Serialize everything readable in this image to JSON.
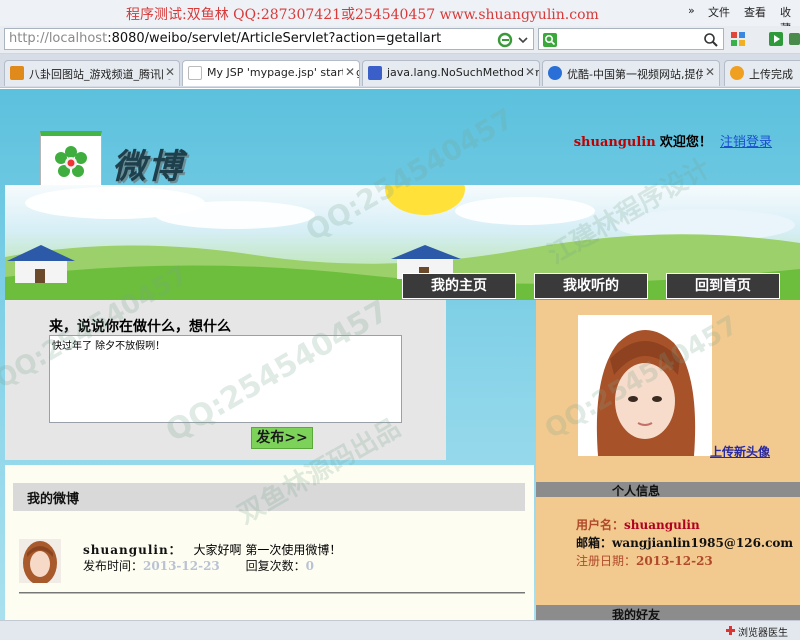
{
  "browser": {
    "window_title": "程序测试:双鱼林 QQ:287307421或254540457 www.shuangyulin.com",
    "menu": {
      "file": "文件",
      "view": "查看",
      "favorites": "收藏"
    },
    "nav_arrows": "»",
    "url_host": "http://localhost",
    "url_path": ":8080/weibo/servlet/ArticleServlet?action=getallart",
    "tabs": [
      {
        "label": "八卦回图站_游戏频道_腾讯网",
        "active": false,
        "favicon_color": "#e08a1c"
      },
      {
        "label": "My JSP 'mypage.jsp' starting",
        "active": true,
        "favicon_color": "#ffffff"
      },
      {
        "label": "java.lang.NoSuchMethodError",
        "active": false,
        "favicon_color": "#3a5fc8"
      },
      {
        "label": "优酷-中国第一视频网站,提供",
        "active": false,
        "favicon_color": "#2a6fd8"
      },
      {
        "label": "上传完成",
        "active": false,
        "favicon_color": "#f0a020"
      }
    ],
    "status_text": "浏览器医生"
  },
  "header": {
    "logo_text": "微博",
    "username": "shuangulin",
    "welcome_text": "欢迎您！",
    "logout_link": "注销登录"
  },
  "nav": [
    {
      "label": "我的主页"
    },
    {
      "label": "我收听的"
    },
    {
      "label": "回到首页"
    }
  ],
  "compose": {
    "title": "来，说说你在做什么，想什么",
    "text_value": "快过年了 除夕不放假咧！",
    "publish_button": "发布>>"
  },
  "feed": {
    "heading": "我的微博",
    "posts": [
      {
        "author": "shuangulin：",
        "content": "大家好啊 第一次使用微博！",
        "time_label": "发布时间：",
        "time_value": "2013-12-23",
        "reply_label": "回复次数：",
        "reply_value": "0"
      }
    ]
  },
  "sidebar": {
    "upload_avatar_link": "上传新头像",
    "personal_info_heading": "个人信息",
    "username_label": "用户名：",
    "username_value": "shuangulin",
    "email_label": "邮箱：",
    "email_value": "wangjianlin1985@126.com",
    "register_label": "注册日期：",
    "register_value": "2013-12-23",
    "friends_heading": "我的好友"
  },
  "watermarks": [
    "QQ:254540457",
    "双鱼林源码出品",
    "江建林程序设计"
  ],
  "colors": {
    "title_red": "#d83a3a",
    "username_red": "#c00000",
    "link_blue": "#1a4fd0",
    "nav_bg": "#3a3a3a",
    "publish_green": "#7dd35a",
    "sidebar_bg": "#f2c98f"
  }
}
